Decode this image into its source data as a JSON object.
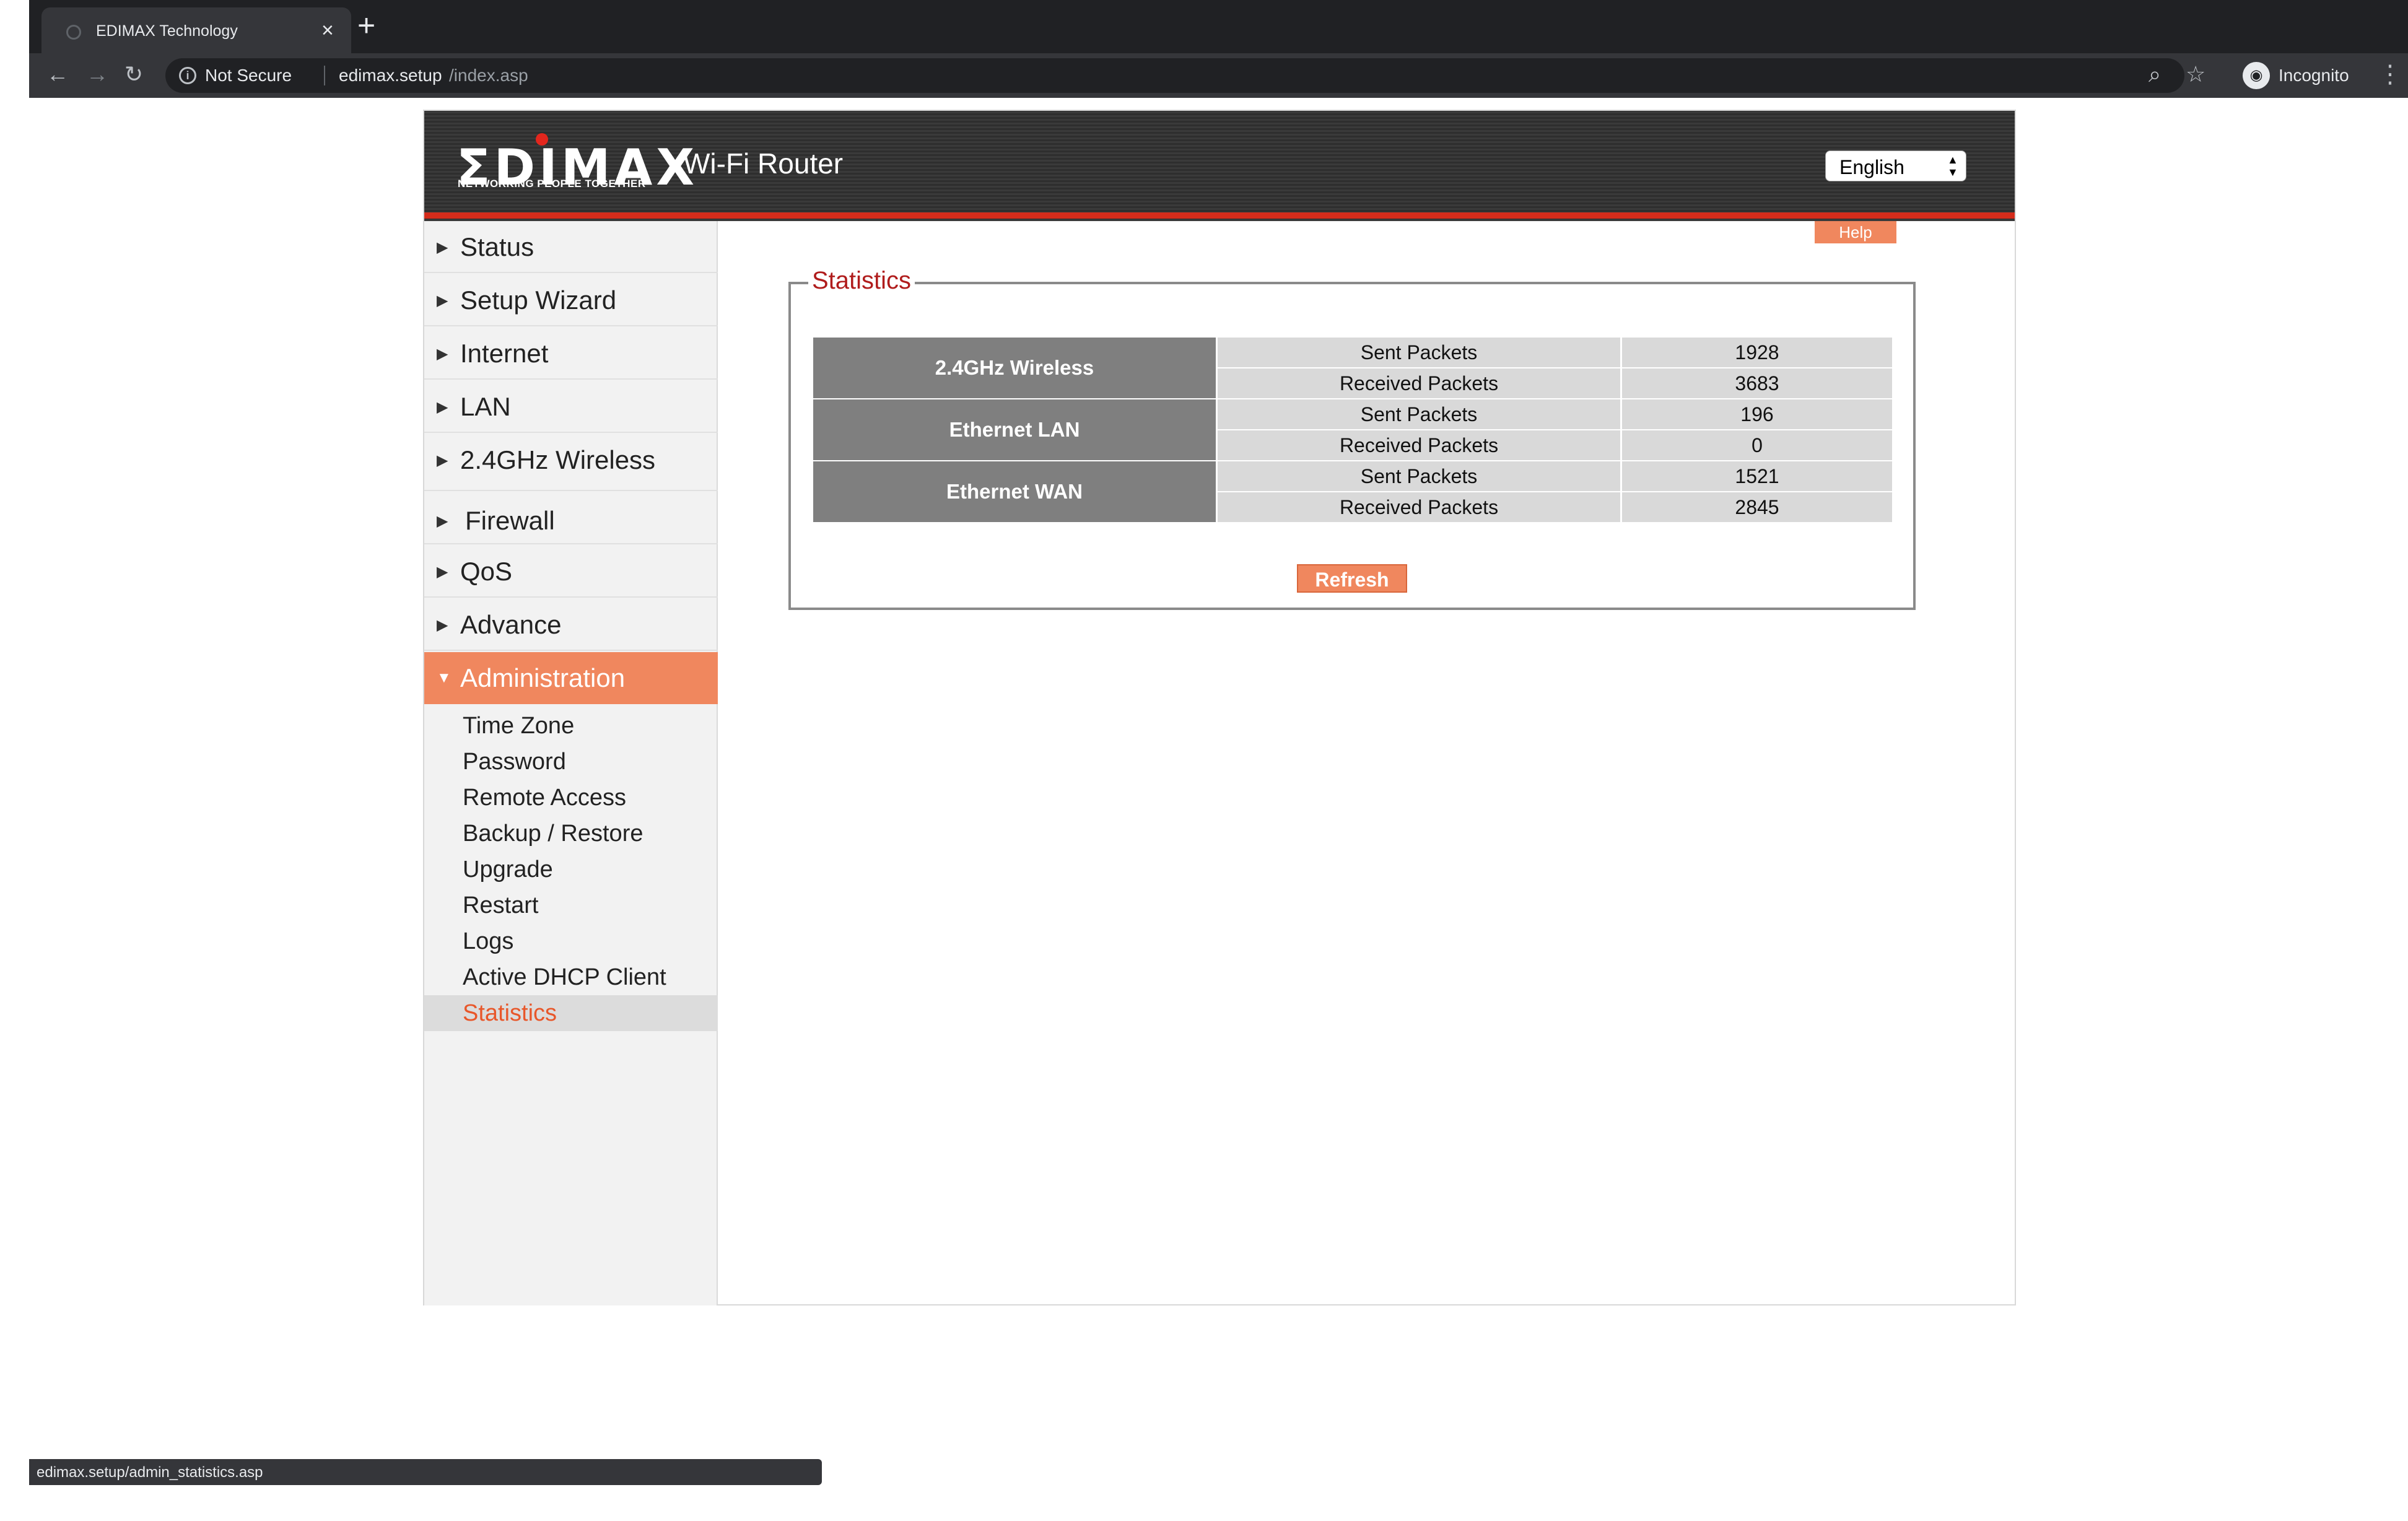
{
  "browser": {
    "tab_title": "EDIMAX Technology",
    "new_tab_symbol": "+",
    "not_secure_label": "Not Secure",
    "url_host": "edimax.setup",
    "url_path": "/index.asp",
    "profile_label": "Incognito",
    "status_url": "edimax.setup/admin_statistics.asp"
  },
  "header": {
    "logo_text": "ΣDIMAX",
    "logo_tagline": "NETWORKING PEOPLE TOGETHER",
    "product_title": "Wi-Fi Router",
    "language": "English"
  },
  "sidebar": {
    "items": [
      {
        "label": "Status"
      },
      {
        "label": "Setup Wizard"
      },
      {
        "label": "Internet"
      },
      {
        "label": "LAN"
      },
      {
        "label": "2.4GHz Wireless"
      },
      {
        "label": "Firewall"
      },
      {
        "label": "QoS"
      },
      {
        "label": "Advance"
      },
      {
        "label": "Administration"
      }
    ],
    "sub_items": [
      {
        "label": "Time Zone"
      },
      {
        "label": "Password"
      },
      {
        "label": "Remote Access"
      },
      {
        "label": "Backup / Restore"
      },
      {
        "label": "Upgrade"
      },
      {
        "label": "Restart"
      },
      {
        "label": "Logs"
      },
      {
        "label": "Active DHCP Client"
      },
      {
        "label": "Statistics"
      }
    ]
  },
  "content": {
    "help_label": "Help",
    "section_title": "Statistics",
    "refresh_label": "Refresh",
    "table": [
      {
        "interface": "2.4GHz  Wireless",
        "sent_label": "Sent Packets",
        "sent": "1928",
        "received_label": "Received Packets",
        "received": "3683"
      },
      {
        "interface": "Ethernet LAN",
        "sent_label": "Sent Packets",
        "sent": "196",
        "received_label": "Received Packets",
        "received": "0"
      },
      {
        "interface": "Ethernet WAN",
        "sent_label": "Sent Packets",
        "sent": "1521",
        "received_label": "Received Packets",
        "received": "2845"
      }
    ]
  },
  "colors": {
    "accent_orange": "#f0875e",
    "header_red": "#d42c1b",
    "legend_red": "#b01c1c",
    "interface_gray": "#7f7f7f"
  }
}
